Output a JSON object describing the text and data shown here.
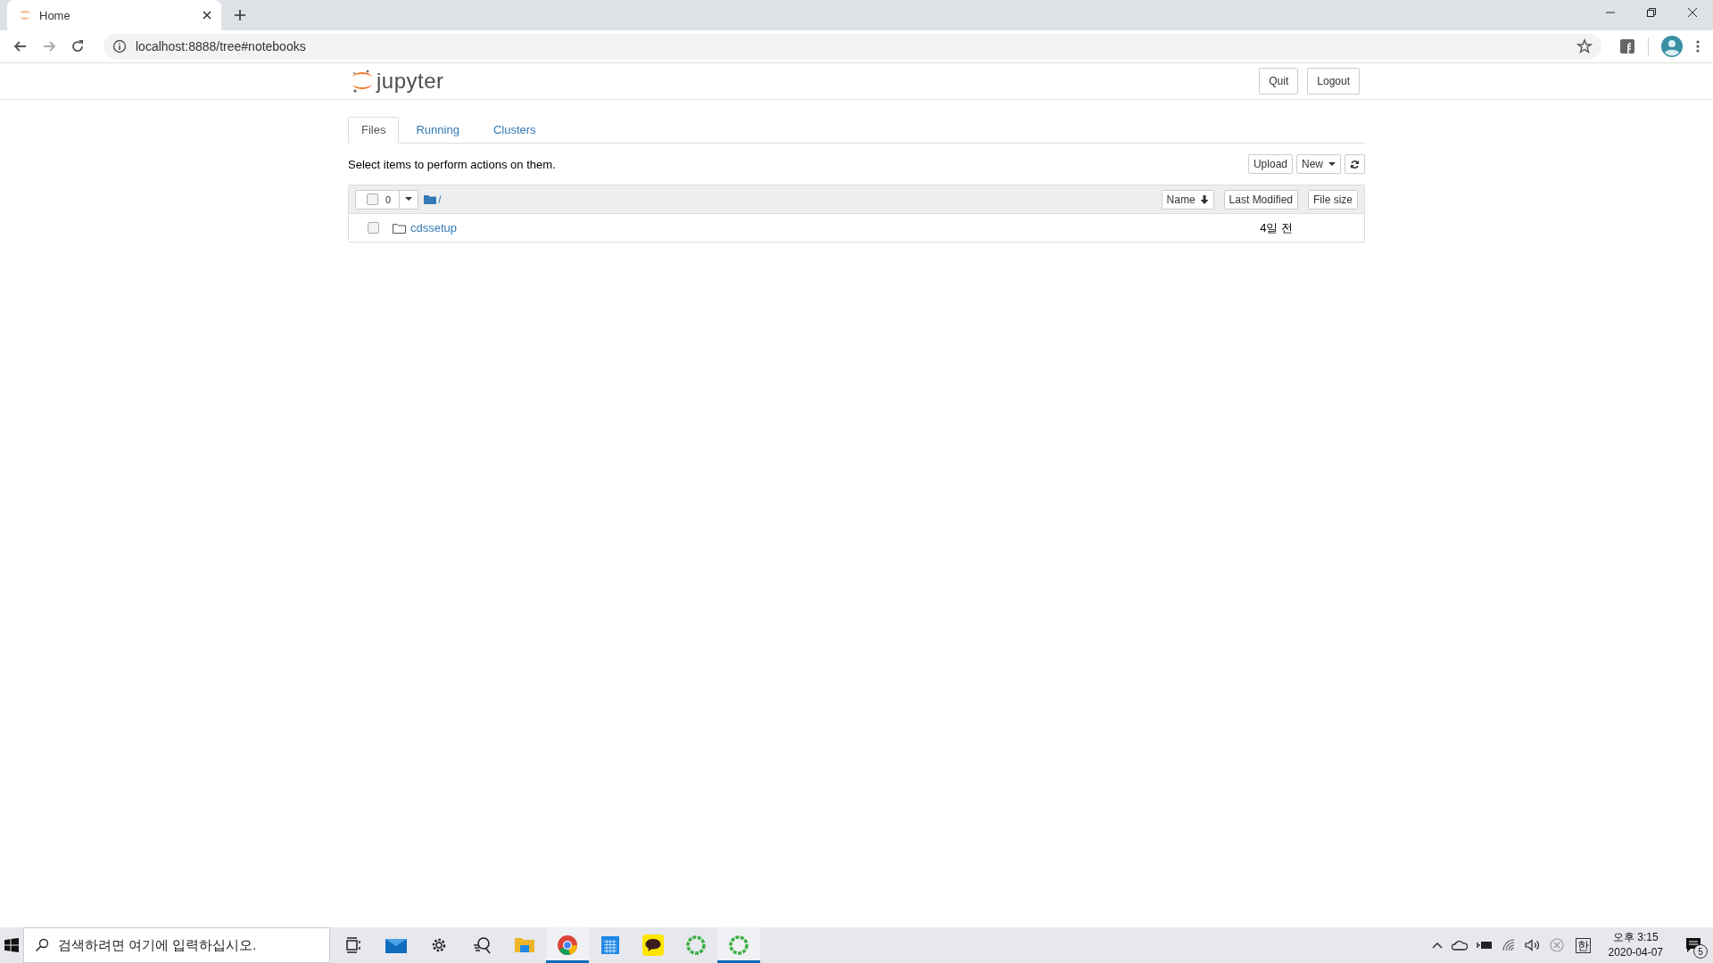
{
  "browser": {
    "tab_title": "Home",
    "address": "localhost:8888/tree#notebooks"
  },
  "header": {
    "logo": "jupyter",
    "buttons": [
      "Quit",
      "Logout"
    ]
  },
  "tabs": [
    {
      "label": "Files",
      "selected": true
    },
    {
      "label": "Running",
      "selected": false
    },
    {
      "label": "Clusters",
      "selected": false
    }
  ],
  "hint": "Select items to perform actions on them.",
  "toolbar": {
    "buttons": [
      "Upload",
      "New"
    ]
  },
  "list": {
    "selected_count": "0",
    "checked": false,
    "path": "/",
    "sort_buttons": [
      "Name",
      "Last Modified",
      "File size"
    ],
    "rows": [
      {
        "name": "cdssetup",
        "modified": "4일 전",
        "checked": false
      }
    ]
  },
  "taskbar": {
    "search_placeholder": "검색하려면 여기에 입력하십시오.",
    "apps": [
      {
        "kind": "taskview",
        "running": false
      },
      {
        "kind": "mail",
        "running": false
      },
      {
        "kind": "settings",
        "running": false
      },
      {
        "kind": "search",
        "running": false
      },
      {
        "kind": "folder",
        "running": false
      },
      {
        "kind": "chrome",
        "running": true
      },
      {
        "kind": "calendar",
        "running": false
      },
      {
        "kind": "chat",
        "running": false
      },
      {
        "kind": "ring",
        "running": false
      },
      {
        "kind": "ring",
        "running": true
      }
    ],
    "ime": "한",
    "time": "오후 3:15",
    "date": "2020-04-07",
    "notifications": "5"
  }
}
